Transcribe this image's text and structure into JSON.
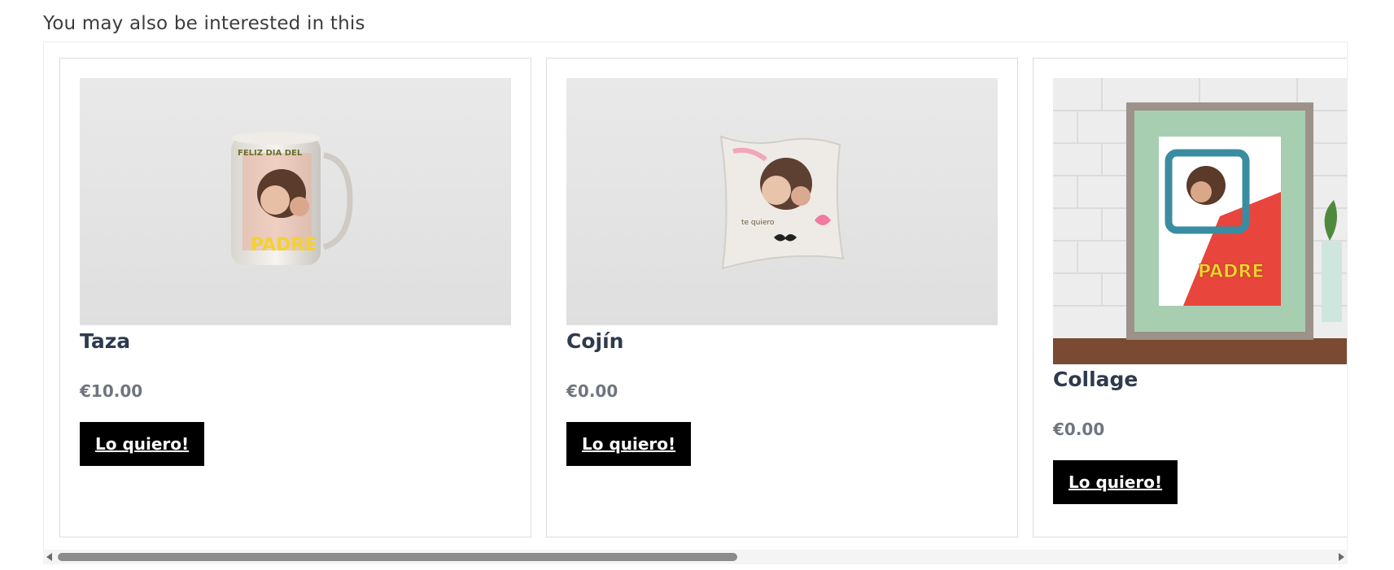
{
  "section": {
    "title": "You may also be interested in this"
  },
  "products": [
    {
      "name": "Taza",
      "price": "€10.00",
      "cta": "Lo quiero!",
      "image": "mug-product-photo",
      "image_text": "FELIZ DIA DEL PADRE"
    },
    {
      "name": "Cojín",
      "price": "€0.00",
      "cta": "Lo quiero!",
      "image": "cushion-product-photo"
    },
    {
      "name": "Collage",
      "price": "€0.00",
      "cta": "Lo quiero!",
      "image": "framed-collage-product-photo",
      "image_text": "PADRE"
    }
  ],
  "colors": {
    "title": "#2e3a4d",
    "price": "#6f7580",
    "button_bg": "#000000",
    "button_text": "#ffffff",
    "card_border": "#dcdcdc"
  }
}
